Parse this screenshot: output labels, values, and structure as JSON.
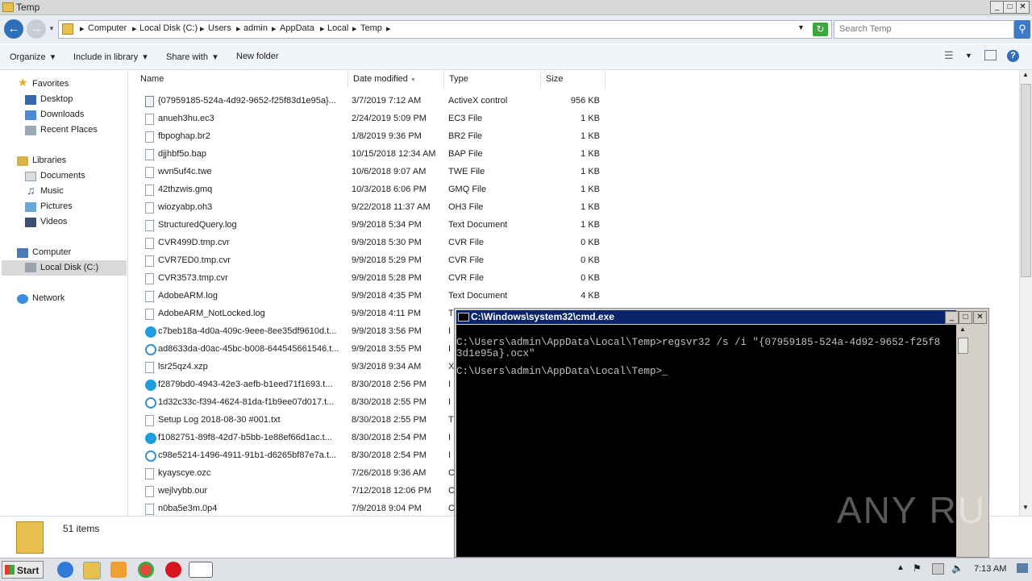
{
  "window": {
    "title": "Temp",
    "min": "_",
    "max": "□",
    "close": "✕"
  },
  "address": {
    "breadcrumbs": [
      "Computer",
      "Local Disk (C:)",
      "Users",
      "admin",
      "AppData",
      "Local",
      "Temp"
    ],
    "search_placeholder": "Search Temp"
  },
  "toolbar": {
    "organize": "Organize",
    "include": "Include in library",
    "share": "Share with",
    "newfolder": "New folder"
  },
  "nav": {
    "favorites": "Favorites",
    "desktop": "Desktop",
    "downloads": "Downloads",
    "recent": "Recent Places",
    "libraries": "Libraries",
    "documents": "Documents",
    "music": "Music",
    "pictures": "Pictures",
    "videos": "Videos",
    "computer": "Computer",
    "localdisk": "Local Disk (C:)",
    "network": "Network"
  },
  "columns": {
    "name": "Name",
    "date": "Date modified",
    "type": "Type",
    "size": "Size"
  },
  "files": [
    {
      "name": "{07959185-524a-4d92-9652-f25f83d1e95a}...",
      "date": "3/7/2019 7:12 AM",
      "type": "ActiveX control",
      "size": "956 KB",
      "icon": "ocx"
    },
    {
      "name": "anueh3hu.ec3",
      "date": "2/24/2019 5:09 PM",
      "type": "EC3 File",
      "size": "1 KB",
      "icon": "file"
    },
    {
      "name": "fbpoghap.br2",
      "date": "1/8/2019 9:36 PM",
      "type": "BR2 File",
      "size": "1 KB",
      "icon": "file"
    },
    {
      "name": "djjhbf5o.bap",
      "date": "10/15/2018 12:34 AM",
      "type": "BAP File",
      "size": "1 KB",
      "icon": "file"
    },
    {
      "name": "wvn5uf4c.twe",
      "date": "10/6/2018 9:07 AM",
      "type": "TWE File",
      "size": "1 KB",
      "icon": "file"
    },
    {
      "name": "42thzwis.gmq",
      "date": "10/3/2018 6:06 PM",
      "type": "GMQ File",
      "size": "1 KB",
      "icon": "file"
    },
    {
      "name": "wiozyabp.oh3",
      "date": "9/22/2018 11:37 AM",
      "type": "OH3 File",
      "size": "1 KB",
      "icon": "file"
    },
    {
      "name": "StructuredQuery.log",
      "date": "9/9/2018 5:34 PM",
      "type": "Text Document",
      "size": "1 KB",
      "icon": "file"
    },
    {
      "name": "CVR499D.tmp.cvr",
      "date": "9/9/2018 5:30 PM",
      "type": "CVR File",
      "size": "0 KB",
      "icon": "file"
    },
    {
      "name": "CVR7ED0.tmp.cvr",
      "date": "9/9/2018 5:29 PM",
      "type": "CVR File",
      "size": "0 KB",
      "icon": "file"
    },
    {
      "name": "CVR3573.tmp.cvr",
      "date": "9/9/2018 5:28 PM",
      "type": "CVR File",
      "size": "0 KB",
      "icon": "file"
    },
    {
      "name": "AdobeARM.log",
      "date": "9/9/2018 4:35 PM",
      "type": "Text Document",
      "size": "4 KB",
      "icon": "file"
    },
    {
      "name": "AdobeARM_NotLocked.log",
      "date": "9/9/2018 4:11 PM",
      "type": "T",
      "size": "",
      "icon": "file"
    },
    {
      "name": "c7beb18a-4d0a-409c-9eee-8ee35df9610d.t...",
      "date": "9/9/2018 3:56 PM",
      "type": "I",
      "size": "",
      "icon": "skype"
    },
    {
      "name": "ad8633da-d0ac-45bc-b008-644545661546.t...",
      "date": "9/9/2018 3:55 PM",
      "type": "I",
      "size": "",
      "icon": "edge"
    },
    {
      "name": "lsr25qz4.xzp",
      "date": "9/3/2018 9:34 AM",
      "type": "X",
      "size": "",
      "icon": "file"
    },
    {
      "name": "f2879bd0-4943-42e3-aefb-b1eed71f1693.t...",
      "date": "8/30/2018 2:56 PM",
      "type": "I",
      "size": "",
      "icon": "skype"
    },
    {
      "name": "1d32c33c-f394-4624-81da-f1b9ee07d017.t...",
      "date": "8/30/2018 2:55 PM",
      "type": "I",
      "size": "",
      "icon": "edge"
    },
    {
      "name": "Setup Log 2018-08-30 #001.txt",
      "date": "8/30/2018 2:55 PM",
      "type": "T",
      "size": "",
      "icon": "file"
    },
    {
      "name": "f1082751-89f8-42d7-b5bb-1e88ef66d1ac.t...",
      "date": "8/30/2018 2:54 PM",
      "type": "I",
      "size": "",
      "icon": "skype"
    },
    {
      "name": "c98e5214-1496-4911-91b1-d6265bf87e7a.t...",
      "date": "8/30/2018 2:54 PM",
      "type": "I",
      "size": "",
      "icon": "edge"
    },
    {
      "name": "kyayscye.ozc",
      "date": "7/26/2018 9:36 AM",
      "type": "C",
      "size": "",
      "icon": "file"
    },
    {
      "name": "wejlvybb.our",
      "date": "7/12/2018 12:06 PM",
      "type": "C",
      "size": "",
      "icon": "file"
    },
    {
      "name": "n0ba5e3m.0p4",
      "date": "7/9/2018 9:04 PM",
      "type": "C",
      "size": "",
      "icon": "file"
    }
  ],
  "status": {
    "count": "51 items"
  },
  "cmd": {
    "title": "C:\\Windows\\system32\\cmd.exe",
    "line1": "C:\\Users\\admin\\AppData\\Local\\Temp>regsvr32 /s /i \"{07959185-524a-4d92-9652-f25f8",
    "line2": "3d1e95a}.ocx\"",
    "line3": "C:\\Users\\admin\\AppData\\Local\\Temp>_"
  },
  "taskbar": {
    "start": "Start",
    "time": "7:13 AM"
  },
  "watermark": "ANY RUN",
  "colors": {
    "cmd_title_bg": "#0a246a",
    "cmd_bg": "#000000",
    "address_bg": "#e7edf3"
  }
}
